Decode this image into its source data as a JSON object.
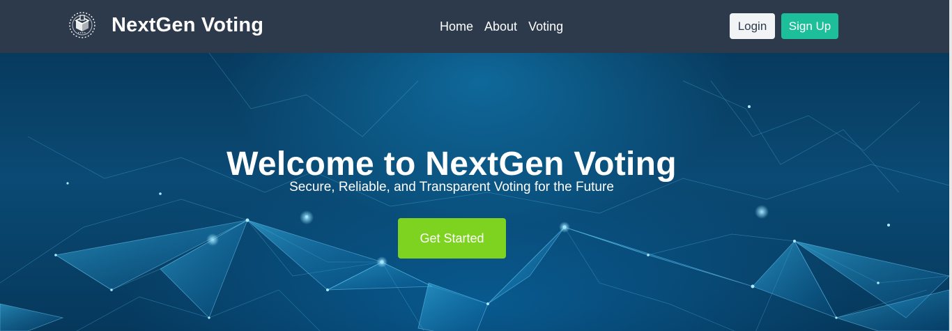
{
  "navbar": {
    "brand_name": "NextGen Voting",
    "logo_icon": "ballot-box-icon",
    "links": [
      {
        "label": "Home"
      },
      {
        "label": "About"
      },
      {
        "label": "Voting"
      }
    ],
    "login_label": "Login",
    "signup_label": "Sign Up"
  },
  "hero": {
    "title": "Welcome to NextGen Voting",
    "subtitle": "Secure, Reliable, and Transparent Voting for the Future",
    "cta_label": "Get Started"
  },
  "colors": {
    "navbar_bg": "#2d3a4c",
    "signup_bg": "#1dbf9a",
    "login_bg": "#f1f3f5",
    "cta_bg": "#7ed321",
    "hero_bg": "#0a4a74"
  }
}
